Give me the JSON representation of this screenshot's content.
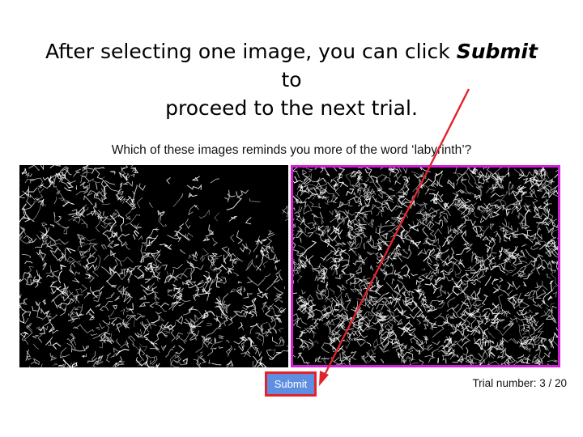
{
  "instruction": {
    "line1_prefix": "After selecting one image, you can click ",
    "emphasis": "Submit",
    "line1_suffix": " to",
    "line2": "proceed to the next trial."
  },
  "question": "Which of these images reminds you more of the word ‘labyrinth’?",
  "images": [
    {
      "name": "left-edge-image",
      "selected": false
    },
    {
      "name": "right-edge-image",
      "selected": true
    }
  ],
  "submit": {
    "label": "Submit"
  },
  "trial": {
    "text": "Trial number: 3 / 20"
  },
  "colors": {
    "selection_border": "#d21ed6",
    "submit_bg": "#5f8ee0",
    "highlight": "#e0242e",
    "arrow": "#e0242e"
  },
  "icons": {
    "arrow": "red-arrow-icon"
  }
}
